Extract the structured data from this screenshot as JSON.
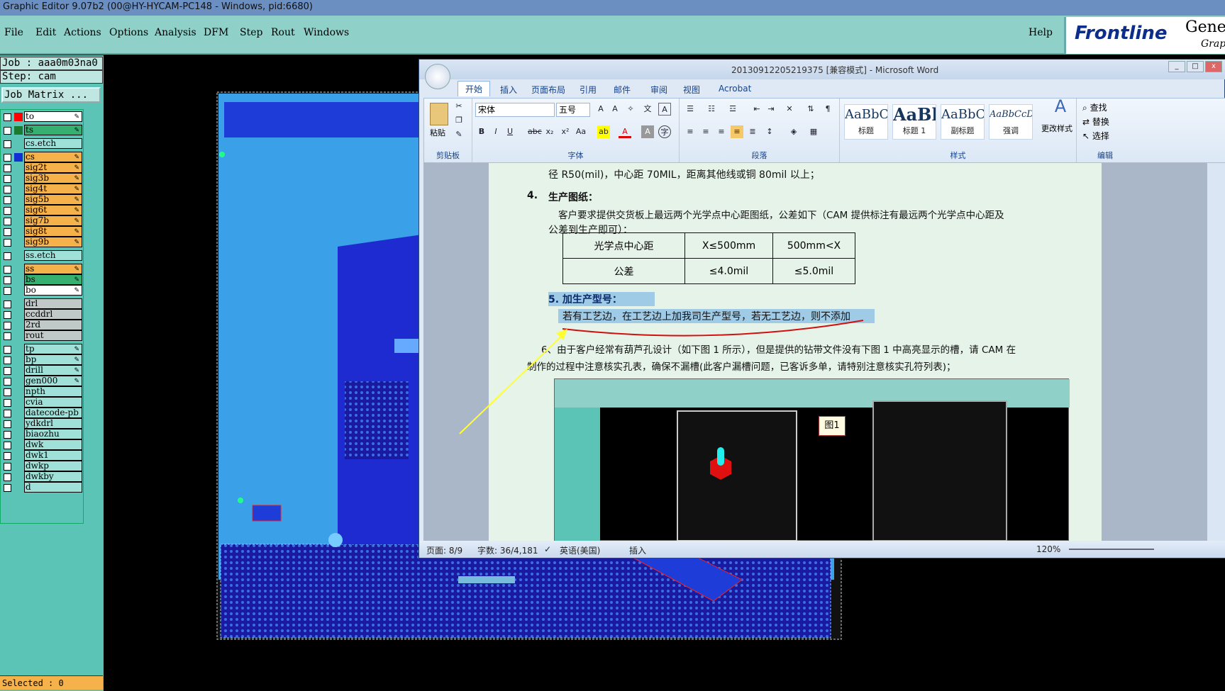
{
  "app": {
    "title": "Graphic Editor 9.07b2 (00@HY-HYCAM-PC148 - Windows, pid:6680)",
    "menu": [
      "File",
      "Edit",
      "Actions",
      "Options",
      "Analysis",
      "DFM",
      "Step",
      "Rout",
      "Windows"
    ],
    "help": "Help",
    "logo_brand": "Frontline",
    "logo_side_1": "Genes",
    "logo_side_2": "Graph"
  },
  "left_panel": {
    "job": "Job : aaa0m03na0",
    "step": "Step: cam",
    "job_matrix": "Job Matrix ...",
    "selected": "Selected : 0",
    "layers": [
      {
        "name": "to",
        "color": "#ff0000",
        "bg": "#ffffff"
      },
      {
        "name": "ts",
        "color": "#1a7a30",
        "bg": "#36b070"
      },
      {
        "name": "cs.etch",
        "color": "",
        "bg": "#9fe0d8"
      },
      {
        "name": "cs",
        "color": "#1030d0",
        "bg": "#f5b24a"
      },
      {
        "name": "sig2t",
        "color": "",
        "bg": "#f5b24a"
      },
      {
        "name": "sig3b",
        "color": "",
        "bg": "#f5b24a"
      },
      {
        "name": "sig4t",
        "color": "",
        "bg": "#f5b24a"
      },
      {
        "name": "sig5b",
        "color": "",
        "bg": "#f5b24a"
      },
      {
        "name": "sig6t",
        "color": "",
        "bg": "#f5b24a"
      },
      {
        "name": "sig7b",
        "color": "",
        "bg": "#f5b24a"
      },
      {
        "name": "sig8t",
        "color": "",
        "bg": "#f5b24a"
      },
      {
        "name": "sig9b",
        "color": "",
        "bg": "#f5b24a"
      },
      {
        "name": "ss.etch",
        "color": "",
        "bg": "#9fe0d8"
      },
      {
        "name": "ss",
        "color": "",
        "bg": "#f5b24a"
      },
      {
        "name": "bs",
        "color": "",
        "bg": "#36b070"
      },
      {
        "name": "bo",
        "color": "",
        "bg": "#ffffff"
      },
      {
        "name": "drl",
        "color": "",
        "bg": "#c0c8c8"
      },
      {
        "name": "ccddrl",
        "color": "",
        "bg": "#c0c8c8"
      },
      {
        "name": "2rd",
        "color": "",
        "bg": "#c0c8c8"
      },
      {
        "name": "rout",
        "color": "",
        "bg": "#c0c8c8"
      },
      {
        "name": "tp",
        "color": "",
        "bg": "#9fe0d8"
      },
      {
        "name": "bp",
        "color": "",
        "bg": "#9fe0d8"
      },
      {
        "name": "drill",
        "color": "",
        "bg": "#9fe0d8"
      },
      {
        "name": "gen000",
        "color": "",
        "bg": "#9fe0d8"
      },
      {
        "name": "npth",
        "color": "",
        "bg": "#9fe0d8"
      },
      {
        "name": "cvia",
        "color": "",
        "bg": "#9fe0d8"
      },
      {
        "name": "datecode-pb",
        "color": "",
        "bg": "#9fe0d8"
      },
      {
        "name": "ydkdrl",
        "color": "",
        "bg": "#9fe0d8"
      },
      {
        "name": "biaozhu",
        "color": "",
        "bg": "#9fe0d8"
      },
      {
        "name": "dwk",
        "color": "",
        "bg": "#9fe0d8"
      },
      {
        "name": "dwk1",
        "color": "",
        "bg": "#9fe0d8"
      },
      {
        "name": "dwkp",
        "color": "",
        "bg": "#9fe0d8"
      },
      {
        "name": "dwkby",
        "color": "",
        "bg": "#9fe0d8"
      },
      {
        "name": "d",
        "color": "",
        "bg": "#9fe0d8"
      }
    ]
  },
  "word": {
    "title": "20130912205219375 [兼容模式] - Microsoft Word",
    "tabs": [
      "开始",
      "插入",
      "页面布局",
      "引用",
      "邮件",
      "审阅",
      "视图",
      "Acrobat"
    ],
    "groups": {
      "clipboard": "剪贴板",
      "font": "字体",
      "paragraph": "段落",
      "styles": "样式",
      "editing": "编辑"
    },
    "paste": "粘贴",
    "font_name": "宋体",
    "font_size": "五号",
    "styles": [
      {
        "preview": "AaBbC",
        "label": "标题"
      },
      {
        "preview": "AaBl",
        "label": "标题 1"
      },
      {
        "preview": "AaBbC",
        "label": "副标题"
      },
      {
        "preview": "AaBbCcD",
        "label": "强调"
      }
    ],
    "change_styles": "更改样式",
    "find": "查找",
    "replace": "替换",
    "select": "选择",
    "doc": {
      "line_top": "径 R50(mil)，中心距 70MIL，距离其他线或铜 80mil 以上；",
      "h4_num": "4.",
      "h4": "生产图纸：",
      "p4a": "客户要求提供交货板上最远两个光学点中心距图纸，公差如下（CAM 提供标注有最远两个光学点中心距及",
      "p4b": "公差到生产即可）：",
      "table": [
        [
          "光学点中心距",
          "X≤500mm",
          "500mm<X"
        ],
        [
          "公差",
          "≤4.0mil",
          "≤5.0mil"
        ]
      ],
      "h5": "5. 加生产型号：",
      "p5": "若有工艺边，在工艺边上加我司生产型号，若无工艺边，则不添加",
      "p6a": "6、由于客户经常有葫芦孔设计（如下图 1 所示），但是提供的钻带文件没有下图 1 中高亮显示的槽，请 CAM 在",
      "p6b": "制作的过程中注意核实孔表，确保不漏槽(此客户漏槽问题，已客诉多单，请特别注意核实孔符列表)；",
      "fig_label": "图1"
    },
    "status": {
      "page": "页面: 8/9",
      "words": "字数: 36/4,181",
      "lang": "英语(美国)",
      "insert": "插入",
      "zoom": "120%"
    }
  }
}
